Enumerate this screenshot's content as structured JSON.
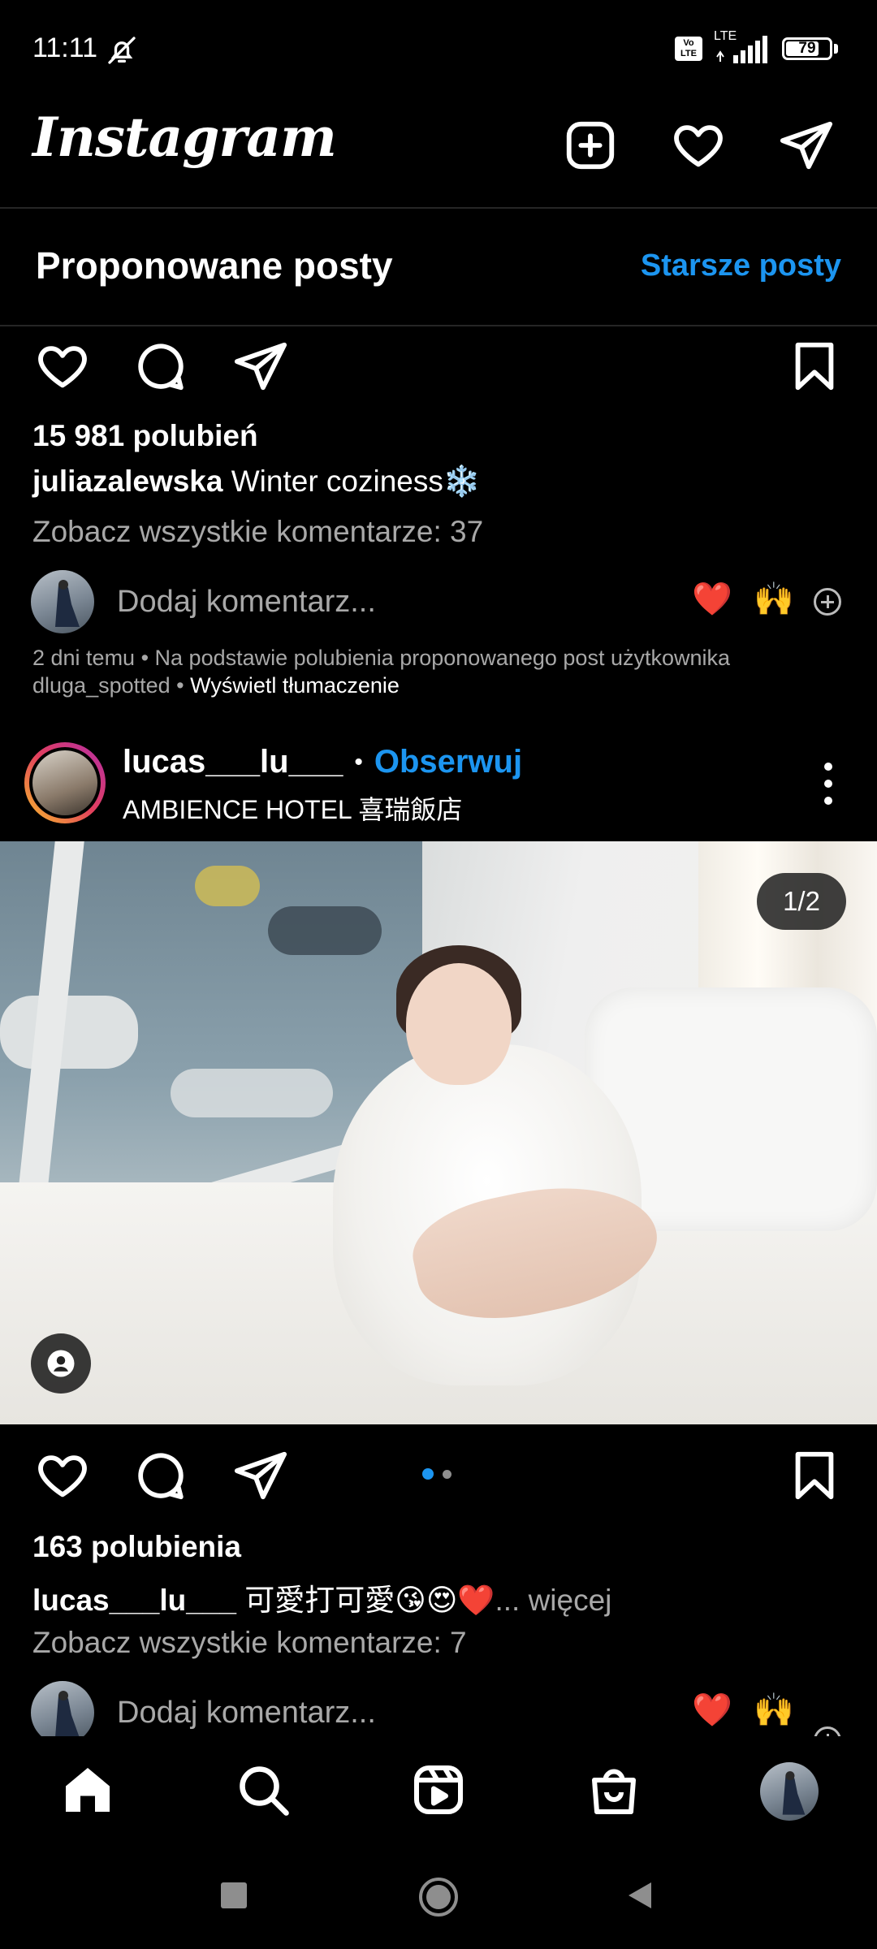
{
  "status_bar": {
    "time": "11:11",
    "volte": "Vo LTE",
    "network": "LTE",
    "battery": "79",
    "battery_level": 0.79
  },
  "header": {
    "logo": "Instagram",
    "icons": [
      "plus-square-icon",
      "heart-icon",
      "send-icon"
    ]
  },
  "suggested": {
    "title": "Proponowane posty",
    "older_link": "Starsze posty"
  },
  "post1": {
    "likes": "15 981 polubień",
    "caption_user": "juliazalewska",
    "caption_text": "Winter coziness❄️",
    "view_comments": "Zobacz wszystkie komentarze: 37",
    "add_comment": "Dodaj komentarz...",
    "quick_emojis": [
      "❤️",
      "🙌"
    ],
    "meta_prefix": "2 dni temu • Na podstawie polubienia proponowanego post użytkownika dluga_spotted • ",
    "meta_translate": "Wyświetl tłumaczenie"
  },
  "post2": {
    "username": "lucas___lu___",
    "follow": "Obserwuj",
    "separator": "•",
    "location": "AMBIENCE HOTEL 喜瑞飯店",
    "counter": "1/2",
    "likes": "163 polubienia",
    "caption_user": "lucas___lu___",
    "caption_text": "可愛打可愛😘😍❤️",
    "more": "... więcej",
    "view_comments": "Zobacz wszystkie komentarze: 7",
    "add_comment": "Dodaj komentarz...",
    "quick_emojis": [
      "❤️",
      "🙌"
    ]
  },
  "bottom_nav": [
    "home-icon",
    "search-icon",
    "reels-icon",
    "shop-icon",
    "profile-avatar"
  ],
  "colors": {
    "background": "#000000",
    "link_blue": "#1c95f0",
    "muted_text": "#a8a8a8",
    "divider": "#262626"
  }
}
